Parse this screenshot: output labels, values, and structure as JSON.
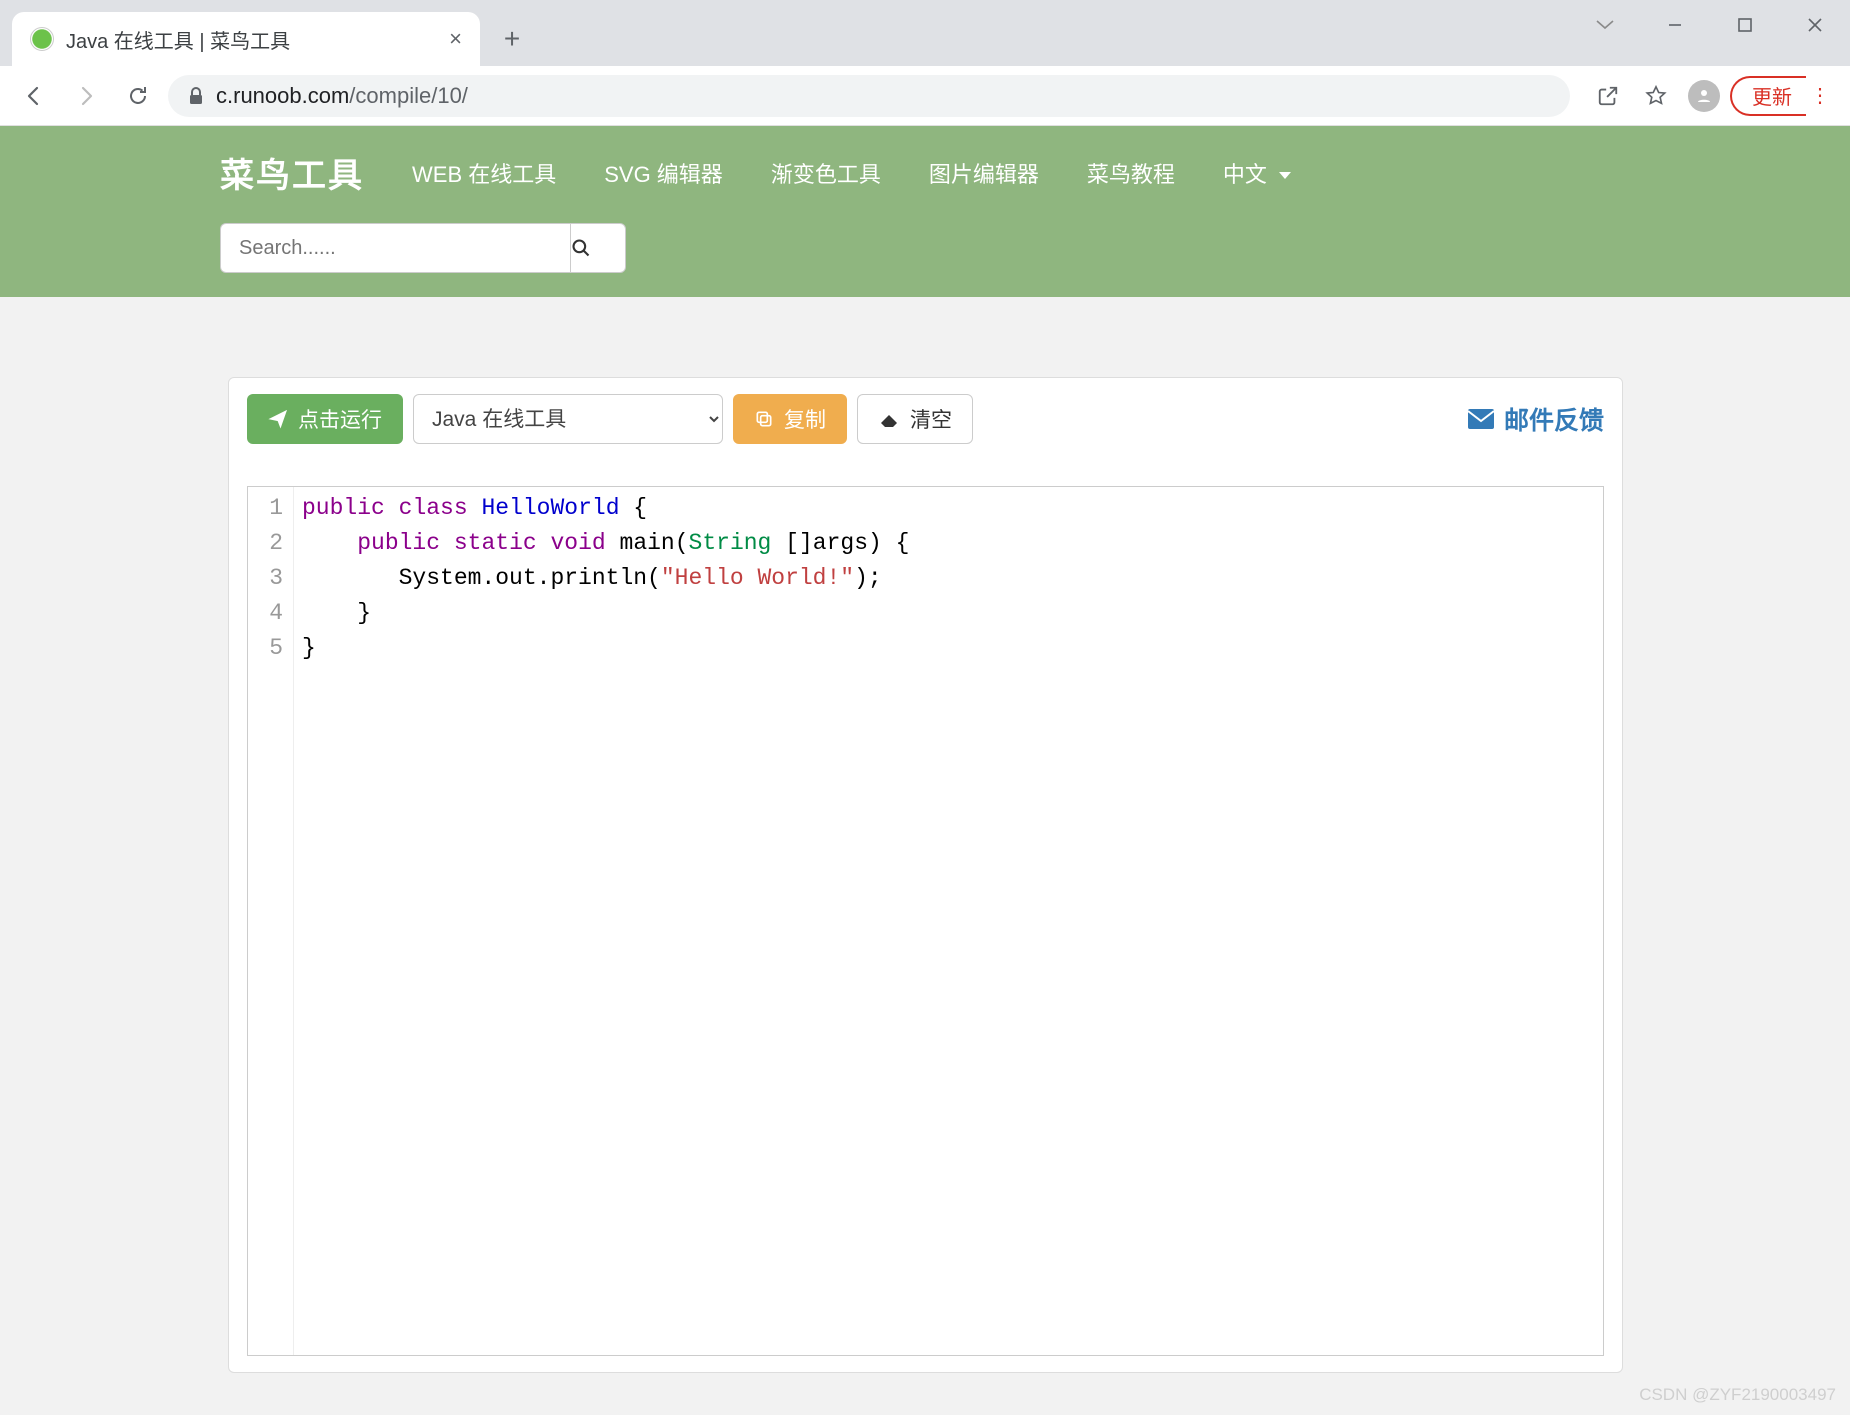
{
  "browser": {
    "tab_title": "Java 在线工具 | 菜鸟工具",
    "url_domain": "c.runoob.com",
    "url_path": "/compile/10/",
    "update_label": "更新"
  },
  "header": {
    "brand": "菜鸟工具",
    "nav": {
      "web_tools": "WEB 在线工具",
      "svg_editor": "SVG 编辑器",
      "gradient": "渐变色工具",
      "image_editor": "图片编辑器",
      "tutorial": "菜鸟教程",
      "language": "中文"
    },
    "search_placeholder": "Search......"
  },
  "toolbar": {
    "run_label": "点击运行",
    "select_value": "Java 在线工具",
    "copy_label": "复制",
    "clear_label": "清空",
    "feedback_label": "邮件反馈"
  },
  "editor": {
    "line_numbers": [
      "1",
      "2",
      "3",
      "4",
      "5"
    ],
    "code": {
      "l1_a": "public",
      "l1_b": "class",
      "l1_c": "HelloWorld",
      "l1_d": " {",
      "l2_a": "    ",
      "l2_b": "public",
      "l2_c": " ",
      "l2_d": "static",
      "l2_e": " ",
      "l2_f": "void",
      "l2_g": " main(",
      "l2_h": "String",
      "l2_i": " []args) {",
      "l3_a": "       System.out.println(",
      "l3_b": "\"Hello World!\"",
      "l3_c": ");",
      "l4": "    }",
      "l5": "}"
    }
  },
  "watermark": "CSDN @ZYF2190003497"
}
